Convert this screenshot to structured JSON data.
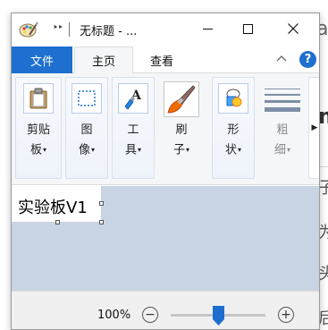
{
  "window": {
    "title": "无标题 - ...",
    "quick_access_chevron": "‣‣"
  },
  "tabs": [
    {
      "label": "文件",
      "active": false
    },
    {
      "label": "主页",
      "active": true
    },
    {
      "label": "查看",
      "active": false
    }
  ],
  "ribbon": {
    "groups": [
      {
        "label_line1": "剪贴",
        "label_line2": "板",
        "icon": "clipboard-icon",
        "enabled": true
      },
      {
        "label_line1": "图",
        "label_line2": "像",
        "icon": "image-select-icon",
        "enabled": true
      },
      {
        "label_line1": "工",
        "label_line2": "具",
        "icon": "tools-icon",
        "enabled": true
      },
      {
        "label_line1": "刷",
        "label_line2": "子",
        "icon": "brush-icon",
        "enabled": true
      },
      {
        "label_line1": "形",
        "label_line2": "状",
        "icon": "shapes-icon",
        "enabled": true
      },
      {
        "label_line1": "粗",
        "label_line2": "细",
        "icon": "line-size-icon",
        "enabled": false
      }
    ],
    "dropdown_arrow": "▾",
    "more_arrow": "▶"
  },
  "canvas": {
    "text": "实验板V1"
  },
  "status": {
    "zoom": "100%",
    "zoom_minus": "−",
    "zoom_plus": "+",
    "zoom_slider_value": 0.5
  },
  "background": {
    "line1": "a",
    "line2": "m",
    "line3": "子",
    "line4": "为",
    "line5": "头",
    "line6": "后"
  },
  "colors": {
    "accent": "#1e6fcf",
    "canvas_background": "#c8d4e4"
  }
}
